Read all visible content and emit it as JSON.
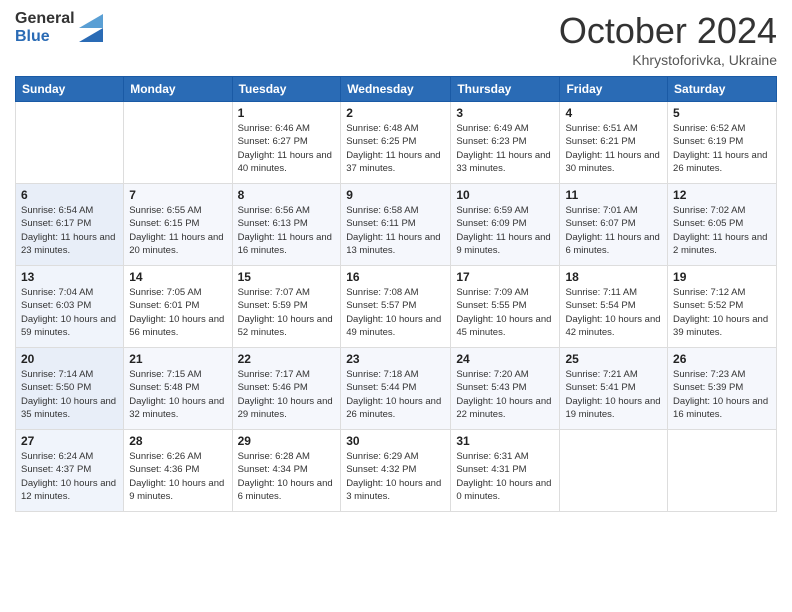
{
  "header": {
    "logo_general": "General",
    "logo_blue": "Blue",
    "month_title": "October 2024",
    "location": "Khrystoforivka, Ukraine"
  },
  "days_of_week": [
    "Sunday",
    "Monday",
    "Tuesday",
    "Wednesday",
    "Thursday",
    "Friday",
    "Saturday"
  ],
  "weeks": [
    [
      {
        "day": "",
        "sunrise": "",
        "sunset": "",
        "daylight": ""
      },
      {
        "day": "",
        "sunrise": "",
        "sunset": "",
        "daylight": ""
      },
      {
        "day": "1",
        "sunrise": "Sunrise: 6:46 AM",
        "sunset": "Sunset: 6:27 PM",
        "daylight": "Daylight: 11 hours and 40 minutes."
      },
      {
        "day": "2",
        "sunrise": "Sunrise: 6:48 AM",
        "sunset": "Sunset: 6:25 PM",
        "daylight": "Daylight: 11 hours and 37 minutes."
      },
      {
        "day": "3",
        "sunrise": "Sunrise: 6:49 AM",
        "sunset": "Sunset: 6:23 PM",
        "daylight": "Daylight: 11 hours and 33 minutes."
      },
      {
        "day": "4",
        "sunrise": "Sunrise: 6:51 AM",
        "sunset": "Sunset: 6:21 PM",
        "daylight": "Daylight: 11 hours and 30 minutes."
      },
      {
        "day": "5",
        "sunrise": "Sunrise: 6:52 AM",
        "sunset": "Sunset: 6:19 PM",
        "daylight": "Daylight: 11 hours and 26 minutes."
      }
    ],
    [
      {
        "day": "6",
        "sunrise": "Sunrise: 6:54 AM",
        "sunset": "Sunset: 6:17 PM",
        "daylight": "Daylight: 11 hours and 23 minutes."
      },
      {
        "day": "7",
        "sunrise": "Sunrise: 6:55 AM",
        "sunset": "Sunset: 6:15 PM",
        "daylight": "Daylight: 11 hours and 20 minutes."
      },
      {
        "day": "8",
        "sunrise": "Sunrise: 6:56 AM",
        "sunset": "Sunset: 6:13 PM",
        "daylight": "Daylight: 11 hours and 16 minutes."
      },
      {
        "day": "9",
        "sunrise": "Sunrise: 6:58 AM",
        "sunset": "Sunset: 6:11 PM",
        "daylight": "Daylight: 11 hours and 13 minutes."
      },
      {
        "day": "10",
        "sunrise": "Sunrise: 6:59 AM",
        "sunset": "Sunset: 6:09 PM",
        "daylight": "Daylight: 11 hours and 9 minutes."
      },
      {
        "day": "11",
        "sunrise": "Sunrise: 7:01 AM",
        "sunset": "Sunset: 6:07 PM",
        "daylight": "Daylight: 11 hours and 6 minutes."
      },
      {
        "day": "12",
        "sunrise": "Sunrise: 7:02 AM",
        "sunset": "Sunset: 6:05 PM",
        "daylight": "Daylight: 11 hours and 2 minutes."
      }
    ],
    [
      {
        "day": "13",
        "sunrise": "Sunrise: 7:04 AM",
        "sunset": "Sunset: 6:03 PM",
        "daylight": "Daylight: 10 hours and 59 minutes."
      },
      {
        "day": "14",
        "sunrise": "Sunrise: 7:05 AM",
        "sunset": "Sunset: 6:01 PM",
        "daylight": "Daylight: 10 hours and 56 minutes."
      },
      {
        "day": "15",
        "sunrise": "Sunrise: 7:07 AM",
        "sunset": "Sunset: 5:59 PM",
        "daylight": "Daylight: 10 hours and 52 minutes."
      },
      {
        "day": "16",
        "sunrise": "Sunrise: 7:08 AM",
        "sunset": "Sunset: 5:57 PM",
        "daylight": "Daylight: 10 hours and 49 minutes."
      },
      {
        "day": "17",
        "sunrise": "Sunrise: 7:09 AM",
        "sunset": "Sunset: 5:55 PM",
        "daylight": "Daylight: 10 hours and 45 minutes."
      },
      {
        "day": "18",
        "sunrise": "Sunrise: 7:11 AM",
        "sunset": "Sunset: 5:54 PM",
        "daylight": "Daylight: 10 hours and 42 minutes."
      },
      {
        "day": "19",
        "sunrise": "Sunrise: 7:12 AM",
        "sunset": "Sunset: 5:52 PM",
        "daylight": "Daylight: 10 hours and 39 minutes."
      }
    ],
    [
      {
        "day": "20",
        "sunrise": "Sunrise: 7:14 AM",
        "sunset": "Sunset: 5:50 PM",
        "daylight": "Daylight: 10 hours and 35 minutes."
      },
      {
        "day": "21",
        "sunrise": "Sunrise: 7:15 AM",
        "sunset": "Sunset: 5:48 PM",
        "daylight": "Daylight: 10 hours and 32 minutes."
      },
      {
        "day": "22",
        "sunrise": "Sunrise: 7:17 AM",
        "sunset": "Sunset: 5:46 PM",
        "daylight": "Daylight: 10 hours and 29 minutes."
      },
      {
        "day": "23",
        "sunrise": "Sunrise: 7:18 AM",
        "sunset": "Sunset: 5:44 PM",
        "daylight": "Daylight: 10 hours and 26 minutes."
      },
      {
        "day": "24",
        "sunrise": "Sunrise: 7:20 AM",
        "sunset": "Sunset: 5:43 PM",
        "daylight": "Daylight: 10 hours and 22 minutes."
      },
      {
        "day": "25",
        "sunrise": "Sunrise: 7:21 AM",
        "sunset": "Sunset: 5:41 PM",
        "daylight": "Daylight: 10 hours and 19 minutes."
      },
      {
        "day": "26",
        "sunrise": "Sunrise: 7:23 AM",
        "sunset": "Sunset: 5:39 PM",
        "daylight": "Daylight: 10 hours and 16 minutes."
      }
    ],
    [
      {
        "day": "27",
        "sunrise": "Sunrise: 6:24 AM",
        "sunset": "Sunset: 4:37 PM",
        "daylight": "Daylight: 10 hours and 12 minutes."
      },
      {
        "day": "28",
        "sunrise": "Sunrise: 6:26 AM",
        "sunset": "Sunset: 4:36 PM",
        "daylight": "Daylight: 10 hours and 9 minutes."
      },
      {
        "day": "29",
        "sunrise": "Sunrise: 6:28 AM",
        "sunset": "Sunset: 4:34 PM",
        "daylight": "Daylight: 10 hours and 6 minutes."
      },
      {
        "day": "30",
        "sunrise": "Sunrise: 6:29 AM",
        "sunset": "Sunset: 4:32 PM",
        "daylight": "Daylight: 10 hours and 3 minutes."
      },
      {
        "day": "31",
        "sunrise": "Sunrise: 6:31 AM",
        "sunset": "Sunset: 4:31 PM",
        "daylight": "Daylight: 10 hours and 0 minutes."
      },
      {
        "day": "",
        "sunrise": "",
        "sunset": "",
        "daylight": ""
      },
      {
        "day": "",
        "sunrise": "",
        "sunset": "",
        "daylight": ""
      }
    ]
  ]
}
